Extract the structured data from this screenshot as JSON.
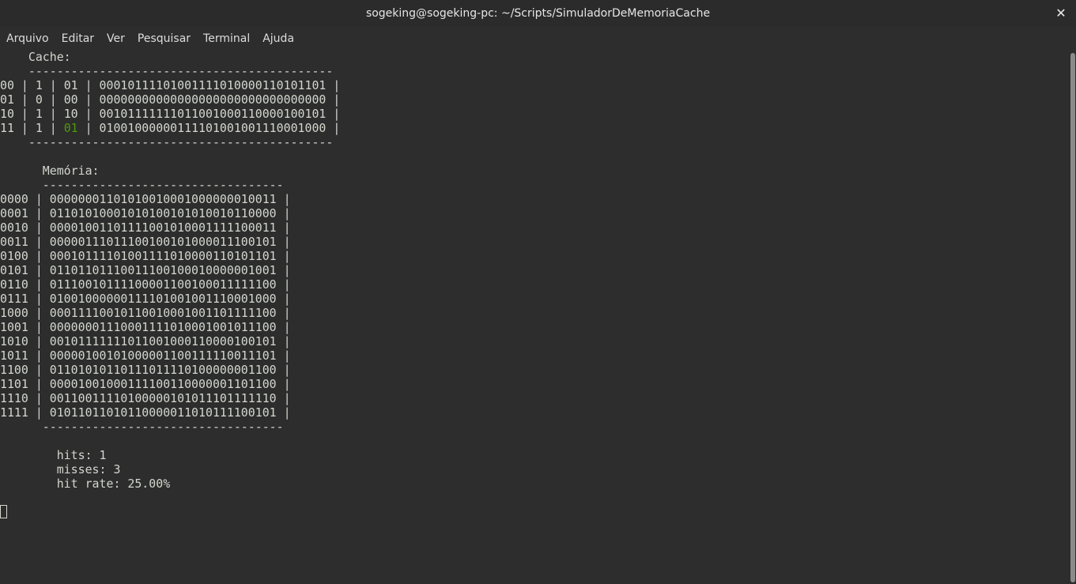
{
  "window": {
    "title": "sogeking@sogeking-pc: ~/Scripts/SimuladorDeMemoriaCache",
    "close_glyph": "✕"
  },
  "menu": [
    "Arquivo",
    "Editar",
    "Ver",
    "Pesquisar",
    "Terminal",
    "Ajuda"
  ],
  "terminal": {
    "cache_label": "    Cache:",
    "cache_separator": "    -------------------------------------------",
    "cache_rows": [
      {
        "pre": "00 | 1 | ",
        "tag": "01",
        "post": " | 00010111101001111010000110101101 |",
        "tag_highlight": false
      },
      {
        "pre": "01 | 0 | ",
        "tag": "00",
        "post": " | 00000000000000000000000000000000 |",
        "tag_highlight": false
      },
      {
        "pre": "10 | 1 | ",
        "tag": "10",
        "post": " | 00101111111011001000110000100101 |",
        "tag_highlight": false
      },
      {
        "pre": "11 | 1 | ",
        "tag": "01",
        "post": " | 01001000000111101001001110001000 |",
        "tag_highlight": true
      }
    ],
    "memory_label": "      Memória:",
    "memory_separator": "      ----------------------------------",
    "memory_rows": [
      "0000 | 00000001101010010001000000010011 |",
      "0001 | 01101010001010100101010010110000 |",
      "0010 | 00001001101111001010001111100011 |",
      "0011 | 00000111011100100101000011100101 |",
      "0100 | 00010111101001111010000110101101 |",
      "0101 | 01101101110011100100010000001001 |",
      "0110 | 01110010111100001100100011111100 |",
      "0111 | 01001000000111101001001110001000 |",
      "1000 | 00011110010110010001001101111100 |",
      "1001 | 00000001110001111010001001011100 |",
      "1010 | 00101111111011001000110000100101 |",
      "1011 | 00000100101000001100111110011101 |",
      "1100 | 01101010110111011110100000001100 |",
      "1101 | 00001001000111100110000001101100 |",
      "1110 | 00110011110100000101011101111110 |",
      "1111 | 01011011010110000011010111100101 |"
    ],
    "stats": [
      "        hits: 1",
      "        misses: 3",
      "        hit rate: 25.00%"
    ]
  }
}
